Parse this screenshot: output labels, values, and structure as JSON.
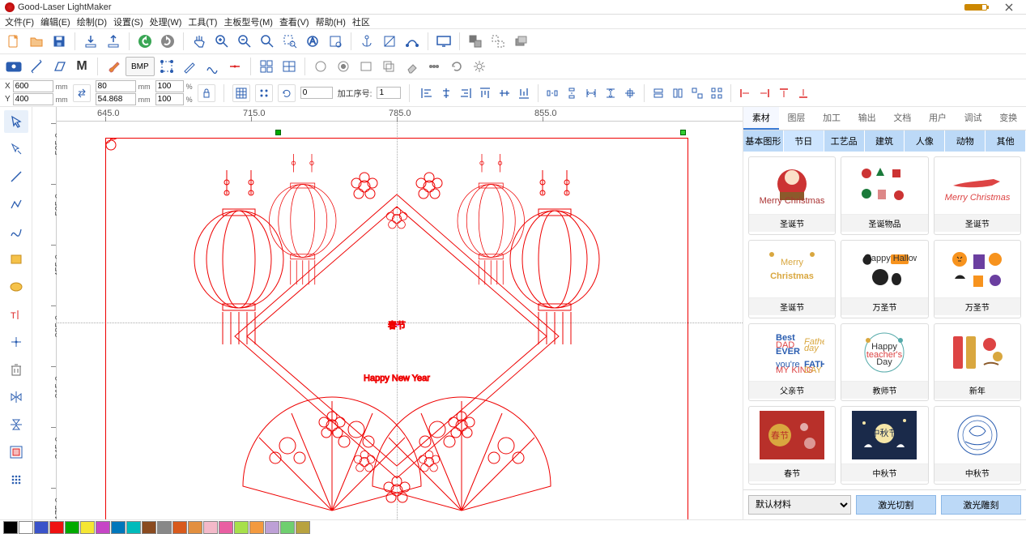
{
  "app": {
    "title": "Good-Laser LightMaker"
  },
  "menu": [
    "文件(F)",
    "编辑(E)",
    "绘制(D)",
    "设置(S)",
    "处理(W)",
    "工具(T)",
    "主板型号(M)",
    "查看(V)",
    "帮助(H)",
    "社区"
  ],
  "coords": {
    "x_label": "X",
    "x_val": "600",
    "y_label": "Y",
    "y_val": "400",
    "w_val": "80",
    "h_val": "54.868",
    "sx_val": "100",
    "sy_val": "100",
    "rot_val": "0",
    "order_label": "加工序号:",
    "order_val": "1",
    "mm": "mm",
    "pct": "%",
    "link_icon": "link"
  },
  "hruler_ticks": [
    "645.0",
    "715.0",
    "785.0",
    "855.0"
  ],
  "vruler_ticks": [
    "595.0",
    "525.0",
    "455.0",
    "385.0",
    "315.0",
    "245.0",
    "175.0"
  ],
  "right": {
    "tabs": [
      "素材",
      "图层",
      "加工",
      "输出",
      "文档",
      "用户",
      "调试",
      "变换"
    ],
    "active_tab": "素材",
    "subtabs": [
      "基本图形",
      "节日",
      "工艺品",
      "建筑",
      "人像",
      "动物",
      "其他"
    ],
    "active_sub": "节日",
    "items": [
      {
        "cap": "圣诞节"
      },
      {
        "cap": "圣诞物品"
      },
      {
        "cap": "圣诞节"
      },
      {
        "cap": "圣诞节"
      },
      {
        "cap": "万圣节"
      },
      {
        "cap": "万圣节"
      },
      {
        "cap": "父亲节"
      },
      {
        "cap": "教师节"
      },
      {
        "cap": "新年"
      },
      {
        "cap": "春节"
      },
      {
        "cap": "中秋节"
      },
      {
        "cap": "中秋节"
      }
    ],
    "material": "默认材料",
    "cut": "激光切割",
    "engrave": "激光雕刻"
  },
  "bmp_label": "BMP",
  "artwork": {
    "big_text": "春节",
    "sub_text": "Happy New Year"
  },
  "colors": [
    "#000000",
    "#ffffff",
    "#3a53c9",
    "#e11",
    "#0a0",
    "#f5e633",
    "#c645c6",
    "#07b",
    "#0bb",
    "#8a4a1f",
    "#888",
    "#d85a1c",
    "#e28f3f",
    "#f3b9c9",
    "#e95fa2",
    "#a7e04a",
    "#f39a3f",
    "#bda0d6",
    "#6fcf6f",
    "#b8a23f"
  ]
}
